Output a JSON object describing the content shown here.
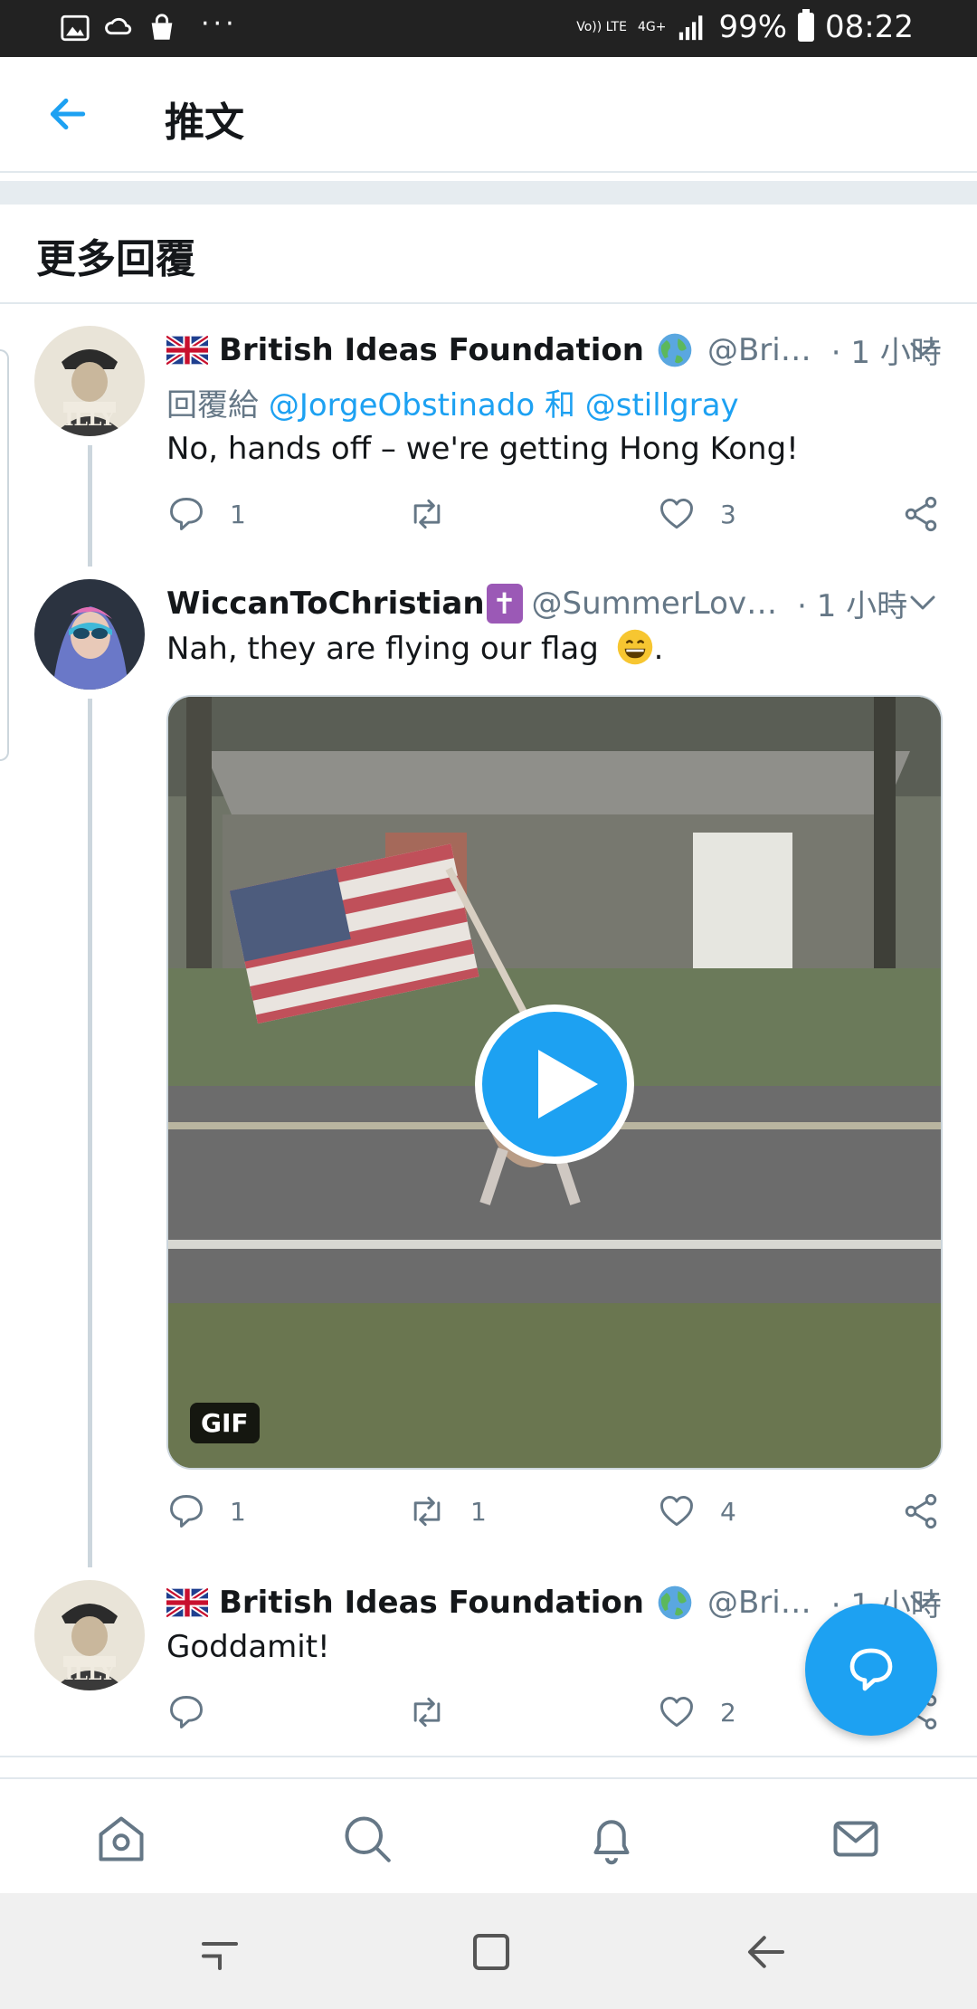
{
  "status_bar": {
    "battery": "99%",
    "time": "08:22",
    "volte": "Vo)) LTE",
    "network": "4G+",
    "dots": "···"
  },
  "header": {
    "title": "推文"
  },
  "section": {
    "title": "更多回覆"
  },
  "tweets": [
    {
      "display_name": "British Ideas Foundation",
      "handle": "@Bri…",
      "time": "· 1 小時",
      "reply_prefix": "回覆給",
      "mention1": "@JorgeObstinado",
      "reply_and": "和",
      "mention2": "@stillgray",
      "text": "No, hands off – we're getting Hong Kong!",
      "reply_count": "1",
      "retweet_count": "",
      "like_count": "3"
    },
    {
      "display_name": "WiccanToChristian",
      "cross": "✝",
      "handle": "@SummerLov…",
      "time": "· 1 小時",
      "text": "Nah, they are flying our flag",
      "text_end": ".",
      "media_badge": "GIF",
      "reply_count": "1",
      "retweet_count": "1",
      "like_count": "4"
    },
    {
      "display_name": "British Ideas Foundation",
      "handle": "@Bri…",
      "time": "· 1 小時",
      "text": "Goddamit!",
      "reply_count": "",
      "retweet_count": "",
      "like_count": "2"
    }
  ],
  "colors": {
    "accent": "#1da1f2",
    "text": "#14171a",
    "secondary": "#657786",
    "border": "#e1e8ed"
  }
}
